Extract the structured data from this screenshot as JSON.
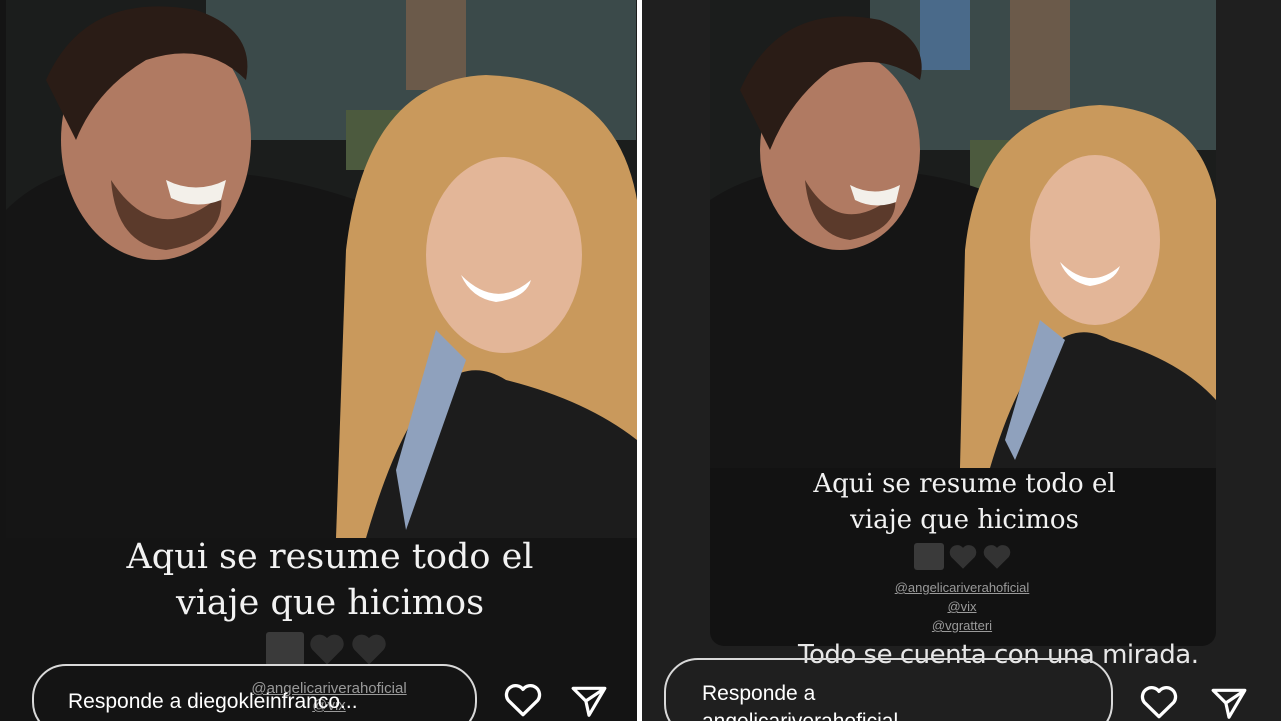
{
  "left_story": {
    "caption_line1": "Aqui se resume todo el",
    "caption_line2": "viaje que hicimos",
    "mentions": [
      "@angelicariverahoficial",
      "@vix"
    ],
    "reply_placeholder": "Responde a diegokleinfranco..."
  },
  "right_story": {
    "caption_line1": "Aqui se resume todo el",
    "caption_line2": "viaje que hicimos",
    "mentions": [
      "@angelicariverahoficial",
      "@vix",
      "@vgratteri"
    ],
    "overlay_text": "Todo se cuenta con una mirada.",
    "reply_line1": "Responde a",
    "reply_line2": "angelicariverahoficial"
  },
  "icons": [
    "clapperboard-icon",
    "black-heart-icon",
    "heart-icon",
    "send-icon"
  ],
  "colors": {
    "background": "#141414",
    "text": "#f2f2f2",
    "mention": "#9a9a9a"
  }
}
